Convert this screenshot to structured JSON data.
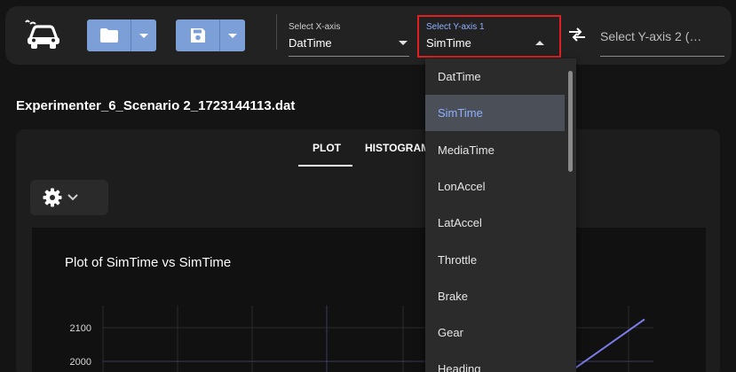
{
  "toolbar": {
    "x_axis": {
      "label": "Select X-axis",
      "value": "DatTime"
    },
    "y_axis_1": {
      "label": "Select Y-axis 1",
      "value": "SimTime"
    },
    "y_axis_2": {
      "placeholder": "Select Y-axis 2 (…"
    }
  },
  "file": {
    "name": "Experimenter_6_Scenario 2_1723144113.dat"
  },
  "tabs": [
    {
      "label": "PLOT",
      "active": true
    },
    {
      "label": "HISTOGRAM",
      "active": false
    }
  ],
  "plot": {
    "title": "Plot of SimTime vs SimTime"
  },
  "dropdown": {
    "items": [
      "DatTime",
      "SimTime",
      "MediaTime",
      "LonAccel",
      "LatAccel",
      "Throttle",
      "Brake",
      "Gear",
      "Heading"
    ],
    "selected": "SimTime"
  },
  "chart_data": {
    "type": "line",
    "title": "Plot of SimTime vs SimTime",
    "y_ticks": [
      2100,
      2000
    ],
    "visible_segment": {
      "y_from": 1980,
      "y_to": 2125
    },
    "line_color": "#7b7be8",
    "grid": true
  },
  "colors": {
    "accent": "#7d9fd8",
    "focus": "#e02020",
    "selected_text": "#8fb0ff"
  }
}
